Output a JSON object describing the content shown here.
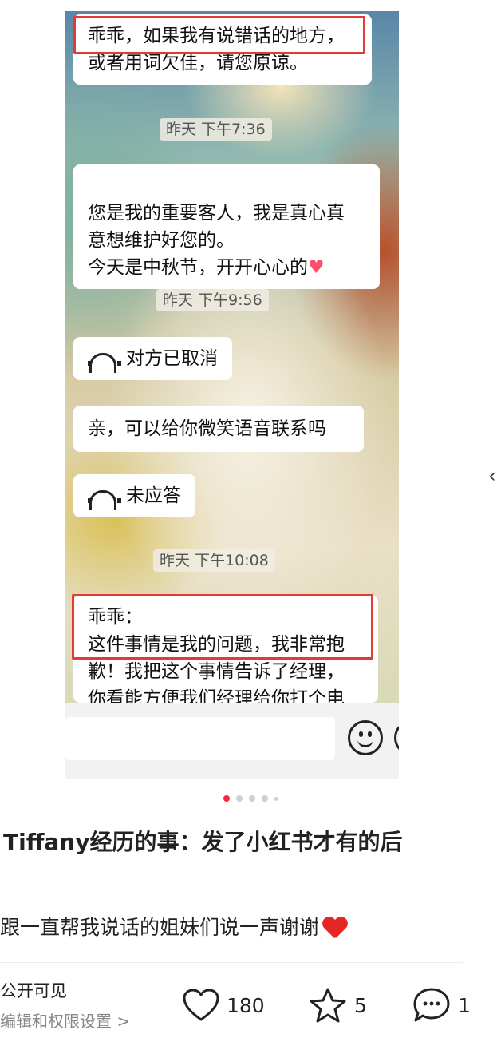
{
  "chat": {
    "msg1": "乖乖，如果我有说错话的地方，\n或者用词欠佳，请您原谅。",
    "time1": "昨天 下午7:36",
    "msg2": "您是我的重要客人，我是真心真\n意想维护好您的。\n今天是中秋节，开开心心的",
    "time2": "昨天 下午9:56",
    "call1": "对方已取消",
    "msg3": "亲，可以给你微笑语音联系吗",
    "call2": "未应答",
    "time3": "昨天 下午10:08",
    "msg4": "乖乖：\n这件事情是我的问题，我非常抱\n歉！我把这个事情告诉了经理，\n你看能方便我们经理给你打个电",
    "highlight_color": "#e53935",
    "heart_color": "#ff4d6d"
  },
  "carousel": {
    "total": 5,
    "active_index": 0
  },
  "post": {
    "title": "Tiffany经历的事：发了小红书才有的后",
    "body": "跟一直帮我说话的姐妹们说一声谢谢",
    "visibility_label": "公开可见",
    "permission_link": "编辑和权限设置 >",
    "likes": "180",
    "collects": "5",
    "comments": "1"
  },
  "colors": {
    "accent": "#ff2442"
  }
}
